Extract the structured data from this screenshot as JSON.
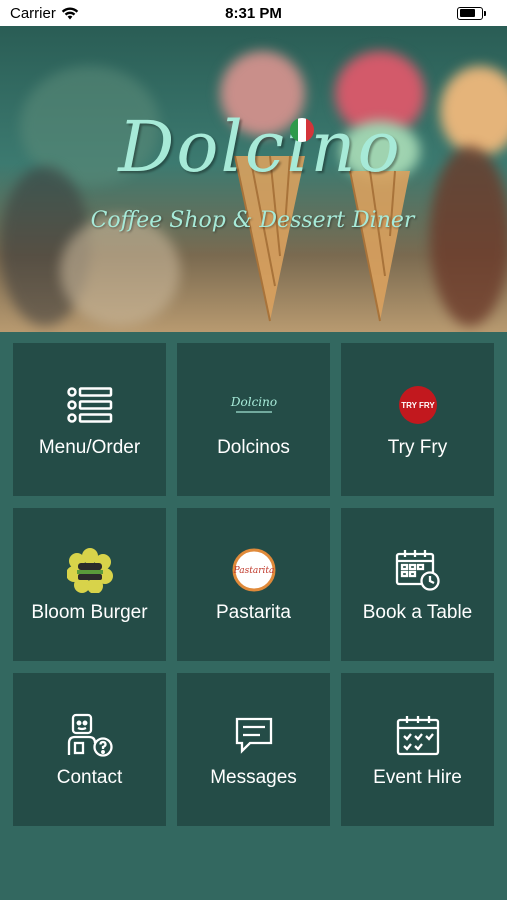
{
  "status_bar": {
    "carrier": "Carrier",
    "time": "8:31 PM"
  },
  "hero": {
    "brand_name": "Dolcino",
    "tagline": "Coffee Shop & Dessert Diner"
  },
  "tiles": [
    {
      "label": "Menu/Order",
      "icon": "list-icon"
    },
    {
      "label": "Dolcinos",
      "icon": "dolcino-logo",
      "logo_text": "Dolcino"
    },
    {
      "label": "Try Fry",
      "icon": "try-fry-logo",
      "logo_text": "TRY FRY"
    },
    {
      "label": "Bloom Burger",
      "icon": "bloom-burger-logo"
    },
    {
      "label": "Pastarita",
      "icon": "pastarita-logo",
      "logo_text": "Pastarita"
    },
    {
      "label": "Book a Table",
      "icon": "calendar-clock-icon"
    },
    {
      "label": "Contact",
      "icon": "contact-support-icon"
    },
    {
      "label": "Messages",
      "icon": "message-icon"
    },
    {
      "label": "Event Hire",
      "icon": "calendar-check-icon"
    }
  ],
  "colors": {
    "background": "#336860",
    "tile": "#244c47",
    "text": "#ffffff",
    "brand": "#a7ead8"
  }
}
